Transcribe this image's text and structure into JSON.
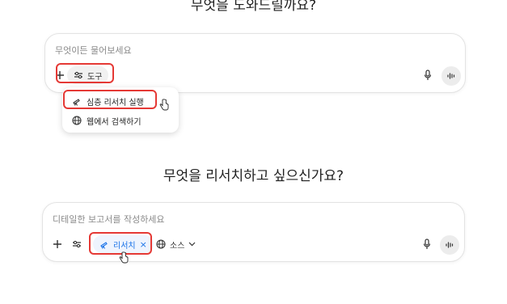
{
  "section1": {
    "heading": "무엇을 도와드릴까요?",
    "placeholder": "무엇이든 물어보세요",
    "tools_label": "도구",
    "menu": [
      {
        "label": "심층 리서치 실행",
        "icon": "telescope-icon"
      },
      {
        "label": "웹에서 검색하기",
        "icon": "globe-icon"
      }
    ]
  },
  "section2": {
    "heading": "무엇을 리서치하고 싶으신가요?",
    "placeholder": "디테일한 보고서를 작성하세요",
    "research_chip": "리서치",
    "research_close": "×",
    "sources_label": "소스"
  },
  "colors": {
    "highlight": "#e53935",
    "accent": "#1a73e8",
    "chip_bg": "#eef4fe"
  }
}
